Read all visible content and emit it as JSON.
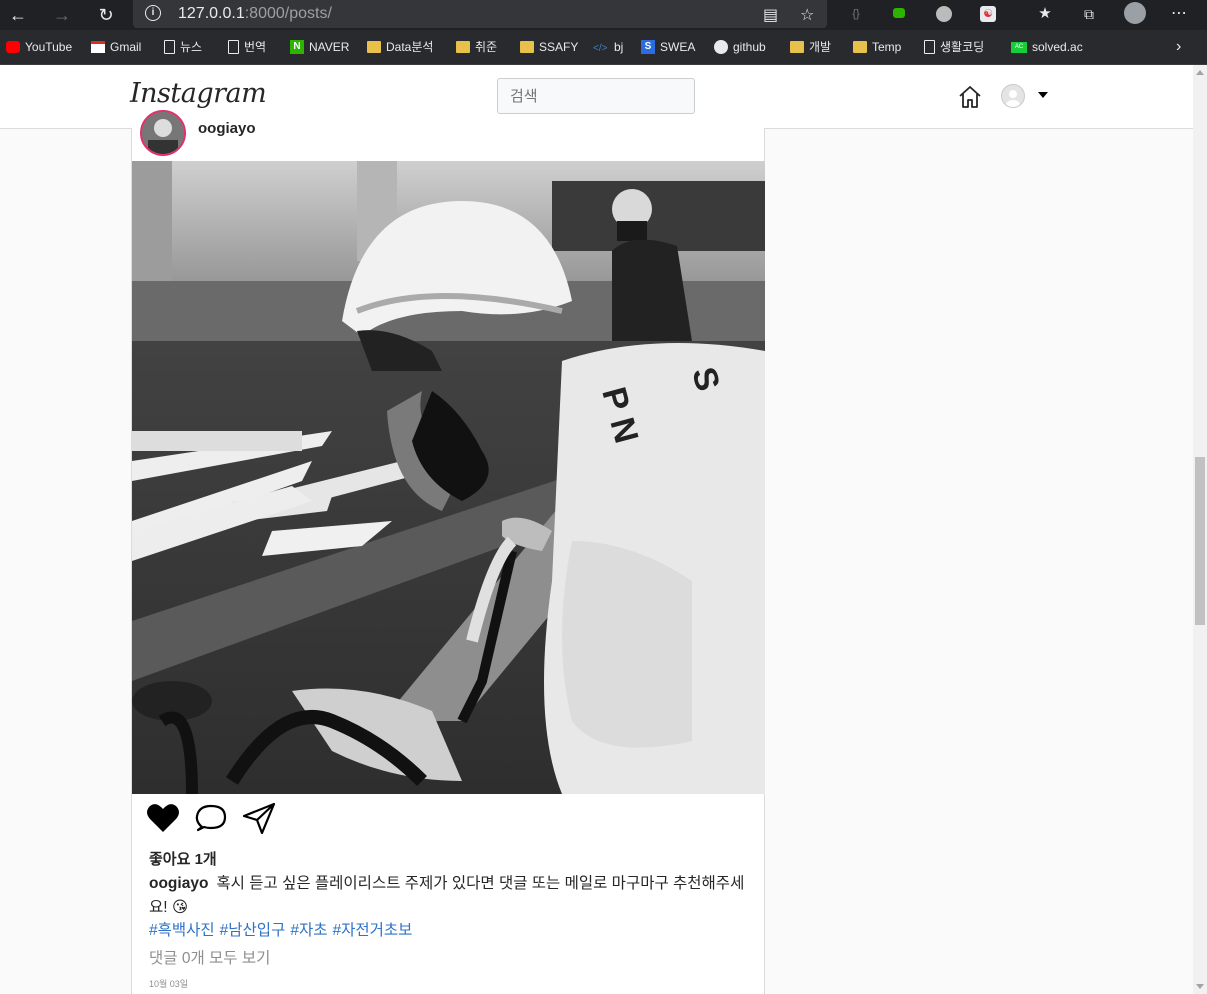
{
  "browser": {
    "url_host": "127.0.0.1",
    "url_rest": ":8000/posts/",
    "bookmarks": [
      {
        "label": "YouTube",
        "icon": "youtube-icon"
      },
      {
        "label": "Gmail",
        "icon": "gmail-icon"
      },
      {
        "label": "뉴스",
        "icon": "page-icon"
      },
      {
        "label": "번역",
        "icon": "page-icon"
      },
      {
        "label": "NAVER",
        "icon": "naver-icon"
      },
      {
        "label": "Data분석",
        "icon": "folder-icon"
      },
      {
        "label": "취준",
        "icon": "folder-icon"
      },
      {
        "label": "SSAFY",
        "icon": "folder-icon"
      },
      {
        "label": "bj",
        "icon": "code-icon"
      },
      {
        "label": "SWEA",
        "icon": "swea-icon"
      },
      {
        "label": "github",
        "icon": "github-icon"
      },
      {
        "label": "개발",
        "icon": "folder-icon"
      },
      {
        "label": "Temp",
        "icon": "folder-icon"
      },
      {
        "label": "생활코딩",
        "icon": "page-icon"
      },
      {
        "label": "solved.ac",
        "icon": "solved-icon"
      }
    ]
  },
  "header": {
    "logo": "Instagram",
    "search_placeholder": "검색"
  },
  "post": {
    "username": "oogiayo",
    "likes": "좋아요 1개",
    "caption_user": "oogiayo",
    "caption_text": "혹시 듣고 싶은 플레이리스트 주제가 있다면 댓글 또는 메일로 마구마구 추천해주세요! 😘",
    "hashtags": [
      "#흑백사진",
      "#남산입구",
      "#자초",
      "#자전거초보"
    ],
    "comments_link": "댓글 0개 모두 보기",
    "date": "10월 03일"
  },
  "colors": {
    "accent_link": "#2f73c7",
    "story_ring": "#e1306c"
  }
}
